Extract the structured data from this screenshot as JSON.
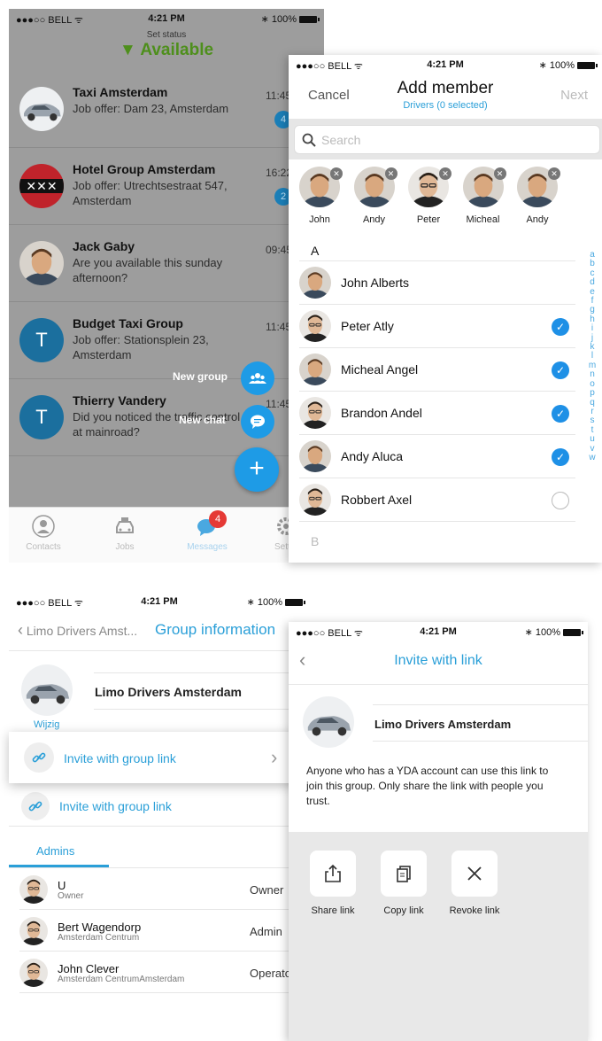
{
  "status_bar": {
    "carrier": "●●●○○ BELL ᯤ",
    "time": "4:21 PM",
    "battery": "∗ 100%"
  },
  "messages_screen": {
    "set_status_label": "Set status",
    "status_value": "▼ Available",
    "conversations": [
      {
        "name": "Taxi Amsterdam",
        "preview": "Job offer: Dam 23, Amsterdam",
        "time": "11:45",
        "badge": "4",
        "avatar": "car"
      },
      {
        "name": "Hotel Group Amsterdam",
        "preview": "Job offer: Utrechtsestraat 547, Amsterdam",
        "time": "16:22",
        "badge": "2",
        "avatar": "xxx"
      },
      {
        "name": "Jack Gaby",
        "preview": "Are you available this sunday afternoon?",
        "time": "09:45",
        "badge": "",
        "avatar": "face"
      },
      {
        "name": "Budget Taxi Group",
        "preview": "Job offer: Stationsplein 23, Amsterdam",
        "time": "11:45",
        "badge": "",
        "avatar": "T"
      },
      {
        "name": "Thierry Vandery",
        "preview": "Did you noticed the traffic control at mainroad?",
        "time": "11:45",
        "badge": "",
        "avatar": "T"
      }
    ],
    "fab_new_group": "New group",
    "fab_new_chat": "New chat",
    "fab_plus": "+",
    "tabs": [
      {
        "label": "Contacts",
        "icon": "person-icon"
      },
      {
        "label": "Jobs",
        "icon": "taxi-icon"
      },
      {
        "label": "Messages",
        "icon": "chat-icon",
        "badge": "4"
      },
      {
        "label": "Settings",
        "icon": "gear-icon"
      }
    ]
  },
  "add_member_screen": {
    "cancel": "Cancel",
    "title": "Add member",
    "subtitle": "Drivers (0 selected)",
    "next": "Next",
    "search_placeholder": "Search",
    "selected": [
      "John",
      "Andy",
      "Peter",
      "Micheal",
      "Andy"
    ],
    "section_a": "A",
    "section_b": "B",
    "contacts": [
      {
        "name": "John Alberts",
        "checked": false,
        "show_radio": false
      },
      {
        "name": "Peter Atly",
        "checked": true,
        "show_radio": true
      },
      {
        "name": "Micheal Angel",
        "checked": true,
        "show_radio": true
      },
      {
        "name": "Brandon Andel",
        "checked": true,
        "show_radio": true
      },
      {
        "name": "Andy Aluca",
        "checked": true,
        "show_radio": true
      },
      {
        "name": "Robbert Axel",
        "checked": false,
        "show_radio": true
      }
    ],
    "alphabet": [
      "a",
      "b",
      "c",
      "d",
      "e",
      "f",
      "g",
      "h",
      "i",
      "j",
      "k",
      "l",
      "m",
      "n",
      "o",
      "p",
      "q",
      "r",
      "s",
      "t",
      "u",
      "v",
      "w"
    ]
  },
  "group_info_screen": {
    "back_label": "Limo Drivers Amst...",
    "title": "Group information",
    "group_name": "Limo Drivers Amsterdam",
    "edit_label": "Wijzig",
    "invite_popup_label": "Invite with group link",
    "invite_label": "Invite with group link",
    "tab_admins": "Admins",
    "members": [
      {
        "name": "U",
        "subtitle": "Owner",
        "role": "Owner"
      },
      {
        "name": "Bert Wagendorp",
        "subtitle": "Amsterdam Centrum",
        "role": "Admin"
      },
      {
        "name": "John Clever",
        "subtitle": "Amsterdam CentrumAmsterdam",
        "role": "Operator"
      }
    ]
  },
  "invite_screen": {
    "title": "Invite with link",
    "group_name": "Limo Drivers Amsterdam",
    "description": "Anyone who has a YDA account can use this link to join this group. Only share the link with people you trust.",
    "actions": [
      {
        "label": "Share link",
        "icon": "share-icon"
      },
      {
        "label": "Copy link",
        "icon": "copy-icon"
      },
      {
        "label": "Revoke link",
        "icon": "close-icon"
      }
    ]
  },
  "colors": {
    "accent": "#2a9fd8",
    "available": "#6ab825",
    "fab": "#1e9be6",
    "badge_red": "#e53935",
    "check": "#1e90e6"
  }
}
